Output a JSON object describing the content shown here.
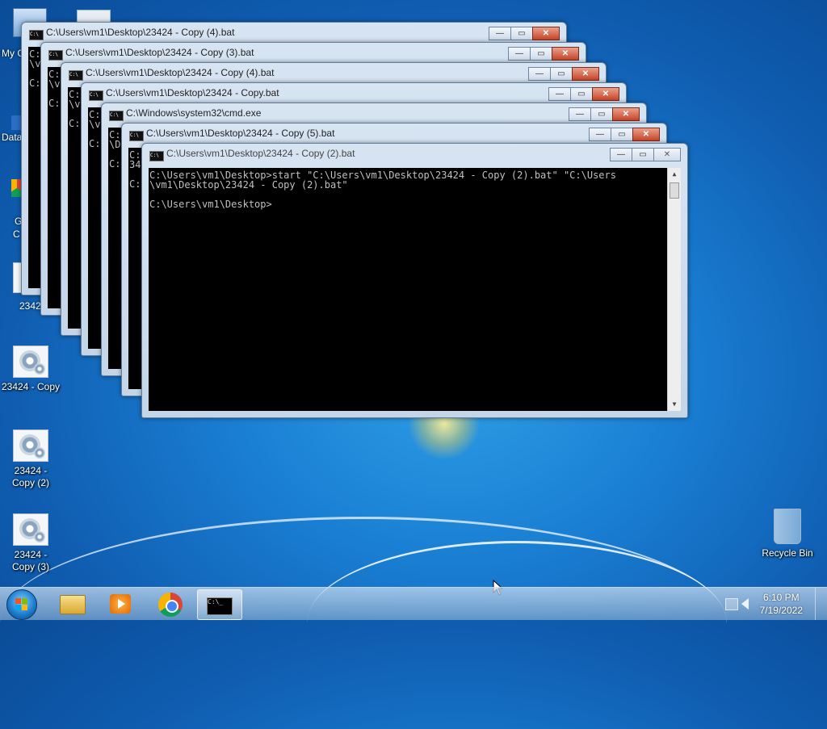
{
  "desktop": {
    "icons": [
      {
        "label": "23424 - Copy"
      },
      {
        "label": "23424 - Copy (2)"
      },
      {
        "label": "23424 - Copy (3)"
      },
      {
        "label": "Recycle Bin"
      }
    ],
    "partial_labels": {
      "my_computer": "My C",
      "data": "Data",
      "g": "G",
      "c": "C",
      "n23424": "23424"
    }
  },
  "windows": [
    {
      "title": "C:\\Users\\vm1\\Desktop\\23424 - Copy (4).bat",
      "peek": [
        "C:",
        "\\v",
        "",
        "C:"
      ]
    },
    {
      "title": "C:\\Users\\vm1\\Desktop\\23424 - Copy (3).bat",
      "peek": [
        "C:",
        "\\v",
        "",
        "C:"
      ]
    },
    {
      "title": "C:\\Users\\vm1\\Desktop\\23424 - Copy (4).bat",
      "peek": [
        "C:",
        "\\v",
        "",
        "C:"
      ]
    },
    {
      "title": "C:\\Users\\vm1\\Desktop\\23424 - Copy.bat",
      "peek": [
        "C:",
        "\\v",
        "",
        "C:"
      ]
    },
    {
      "title": "C:\\Windows\\system32\\cmd.exe",
      "peek": [
        "C:",
        "\\D",
        "",
        "C:"
      ]
    },
    {
      "title": "C:\\Users\\vm1\\Desktop\\23424 - Copy (5).bat",
      "peek": [
        "C:",
        "34",
        "",
        "C:"
      ]
    },
    {
      "title": "C:\\Users\\vm1\\Desktop\\23424 - Copy (2).bat",
      "console": [
        "C:\\Users\\vm1\\Desktop>start \"C:\\Users\\vm1\\Desktop\\23424 - Copy (2).bat\" \"C:\\Users",
        "\\vm1\\Desktop\\23424 - Copy (2).bat\"",
        "",
        "C:\\Users\\vm1\\Desktop>"
      ]
    }
  ],
  "window_controls": {
    "minimize": "—",
    "maximize": "▭",
    "close": "✕"
  },
  "scroll": {
    "up": "▲",
    "down": "▼"
  },
  "tray": {
    "time": "6:10 PM",
    "date": "7/19/2022"
  },
  "taskbar": {
    "items": [
      "folder",
      "media-player",
      "chrome",
      "cmd"
    ],
    "cmd_glyph": "C:\\_"
  },
  "colors": {
    "console_bg": "#000000",
    "console_fg": "#c0c0c0",
    "close_red": "#c8452a"
  }
}
